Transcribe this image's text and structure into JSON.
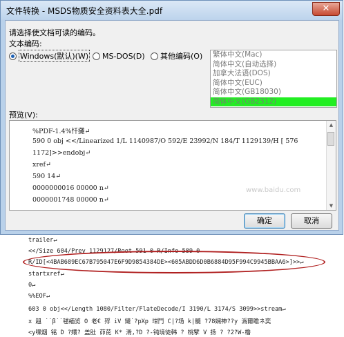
{
  "dialog": {
    "title": "文件转换 - MSDS物质安全资料表大全.pdf",
    "close_glyph": "✕",
    "prompt": "请选择使文档可读的编码。",
    "encoding_label": "文本编码:",
    "radios": [
      {
        "label": "Windows(默认)(W)",
        "checked": true
      },
      {
        "label": "MS-DOS(D)",
        "checked": false
      },
      {
        "label": "其他编码(O)",
        "checked": false
      }
    ],
    "encoding_list": [
      "繁体中文(Mac)",
      "简体中文(自动选择)",
      "加拿大法语(DOS)",
      "简体中文(EUC)",
      "简体中文(GB18030)",
      "简体中文(GB2312)"
    ],
    "selected_encoding_index": 5,
    "highlight_color": "#22ee22",
    "preview_label": "预览(V):",
    "preview_lines": [
      "%PDF-1.4%忏攤↵",
      "590 0 obj <</Linearized 1/L 1140987/O 592/E 23992/N 184/T 1129139/H [ 576",
      "1172]>>endobj↵",
      "xref↵",
      "590 14↵",
      "0000000016 00000 n↵",
      "0000001748 00000 n↵"
    ],
    "ok_label": "确定",
    "cancel_label": "取消"
  },
  "watermark": "www.baidu.com",
  "document_lines": [
    "trailer↵",
    "<</Size     604/Prev     1129127/Root     591     0     R/Info     589     0",
    "R/ID[<4BAB689EC67B795047E6F9D9854384DE><605ABDD6D0B6884D95F994C9945BBAA6>]>>↵",
    "startxref↵",
    "0↵",
    "%%EOF↵",
    "603 0 obj<</Length 1080/Filter/FlateDecode/I 3190/L 3174/S 3099>>stream↵",
    "x 趄 ˙˙β˙˙毬緬览 O 老€     殍 iV  鏈˙?pXp 坩鬥 C|?场 k|髓     ?78娴神??y    潙爾瞻ネ奕",
    "<y嘿烟   铭 D   ?嬛?   盖肚   茆芘 K*      滑,?D    ?‐钝境徒韩    ?      桃孼 V 扬    ?   ?2?W‐橹"
  ],
  "annotation_color": "#b02020"
}
